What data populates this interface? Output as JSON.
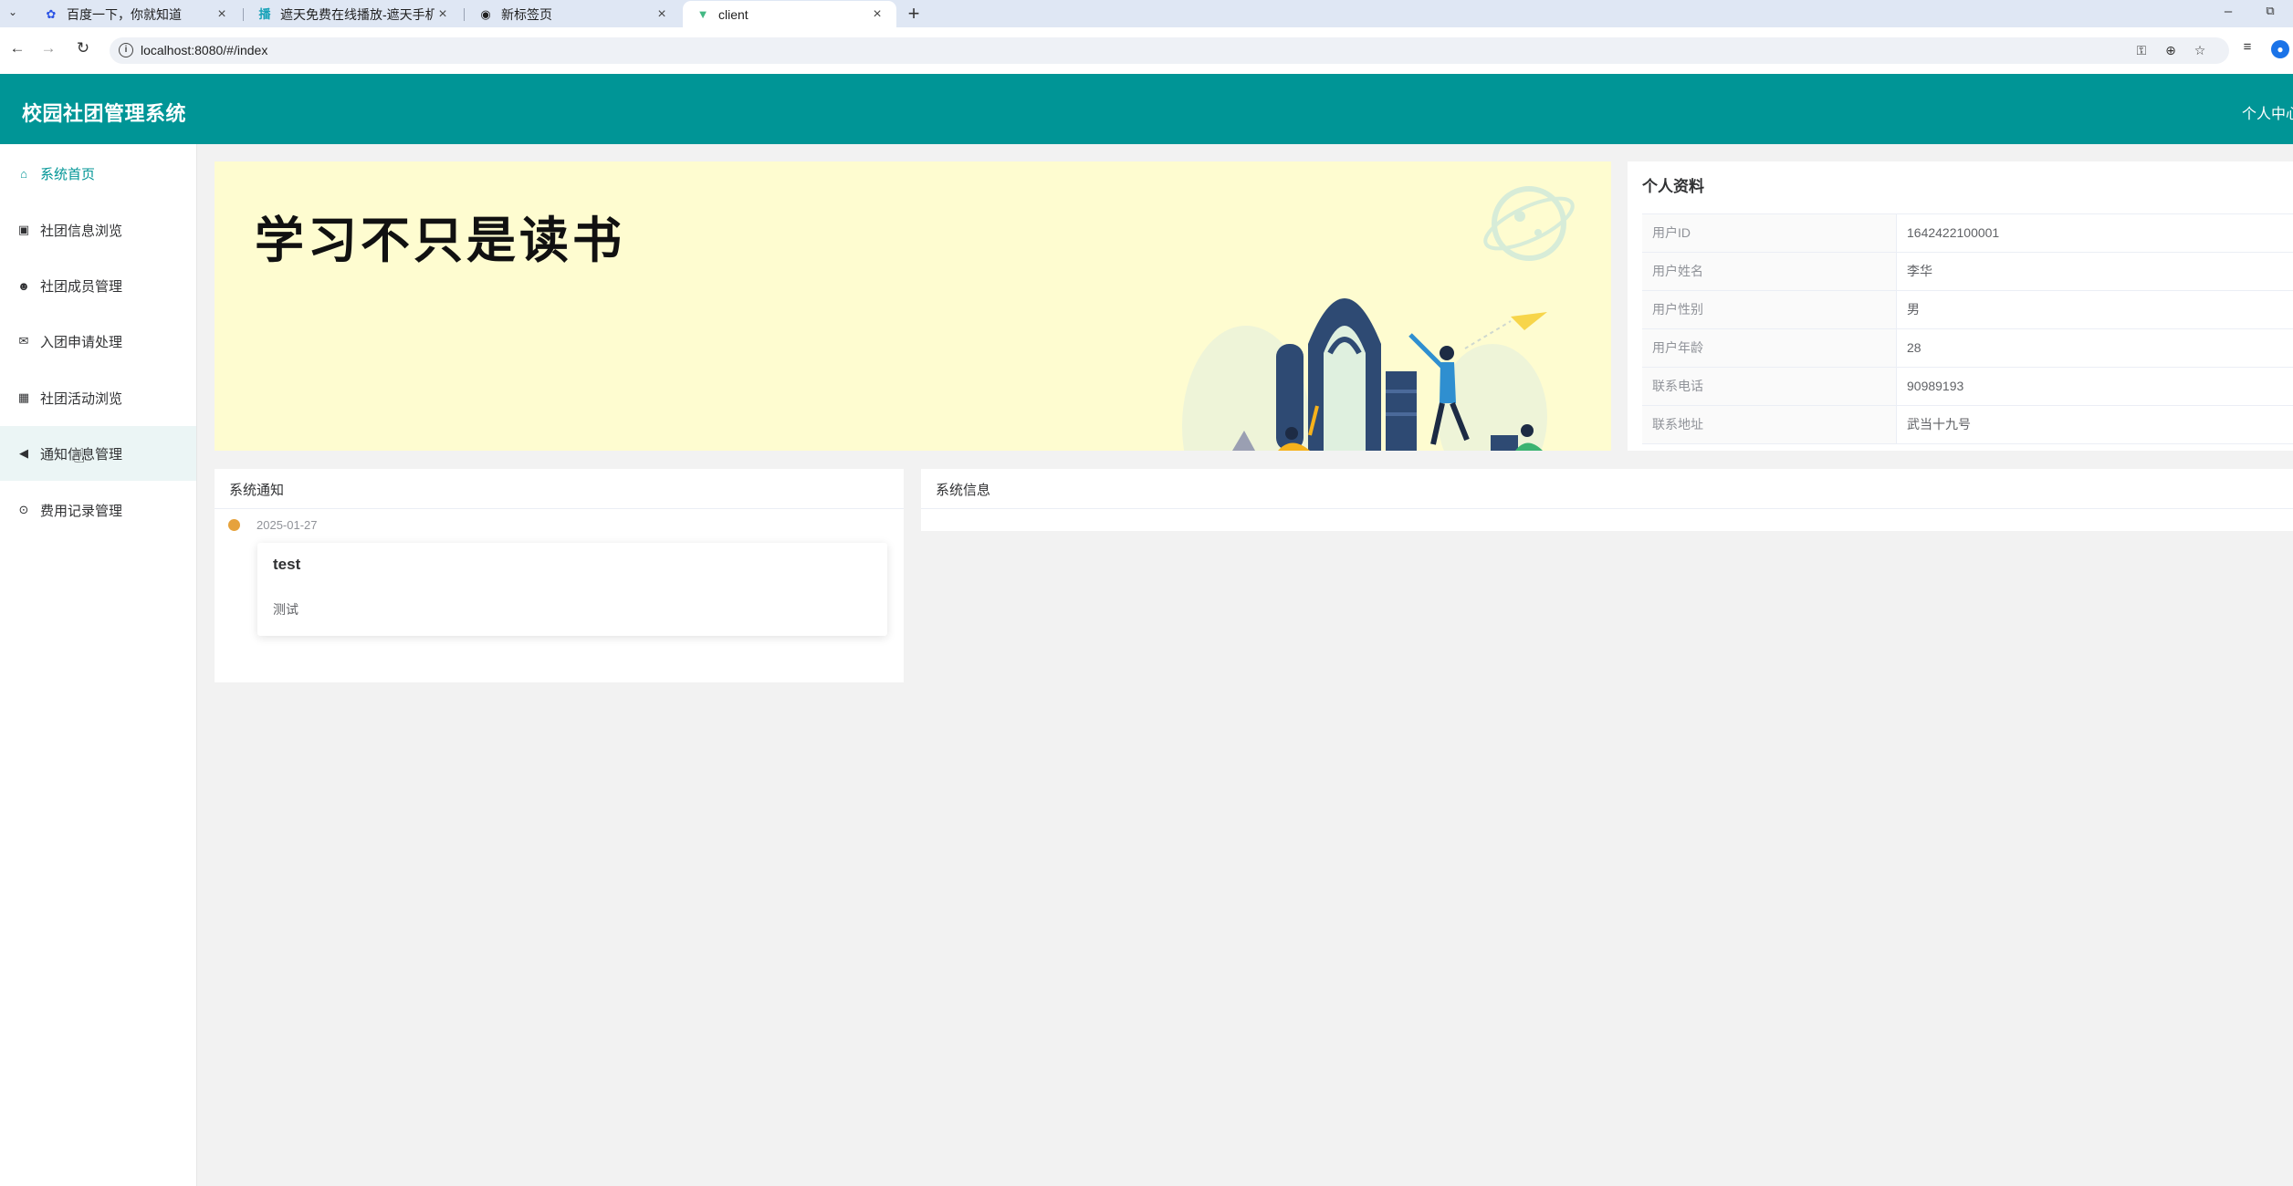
{
  "browser": {
    "tabs": [
      {
        "label": "百度一下，你就知道",
        "icon": "baidu-paw-icon"
      },
      {
        "label": "遮天免费在线播放-遮天手机高清",
        "icon": "video-site-icon"
      },
      {
        "label": "新标签页",
        "icon": "chrome-icon"
      },
      {
        "label": "client",
        "icon": "vue-logo-icon"
      }
    ],
    "active_tab": 3,
    "url": "localhost:8080/#/index"
  },
  "app": {
    "title": "校园社团管理系统",
    "user_center": "个人中心",
    "accent": "#009596"
  },
  "sidebar": {
    "items": [
      {
        "label": "系统首页",
        "icon": "home-icon"
      },
      {
        "label": "社团信息浏览",
        "icon": "train-icon"
      },
      {
        "label": "社团成员管理",
        "icon": "users-icon"
      },
      {
        "label": "入团申请处理",
        "icon": "envelope-icon"
      },
      {
        "label": "社团活动浏览",
        "icon": "calculator-icon"
      },
      {
        "label": "通知信息管理",
        "icon": "megaphone-icon"
      },
      {
        "label": "费用记录管理",
        "icon": "circle-icon"
      }
    ],
    "active_index": 0,
    "hover_index": 5
  },
  "banner": {
    "text": "学习不只是读书",
    "background": "#fefcd0"
  },
  "profile": {
    "title": "个人资料",
    "rows": [
      {
        "key": "用户ID",
        "value": "1642422100001"
      },
      {
        "key": "用户姓名",
        "value": "李华"
      },
      {
        "key": "用户性别",
        "value": "男"
      },
      {
        "key": "用户年龄",
        "value": "28"
      },
      {
        "key": "联系电话",
        "value": "90989193"
      },
      {
        "key": "联系地址",
        "value": "武当十九号"
      }
    ]
  },
  "notice": {
    "title": "系统通知",
    "items": [
      {
        "date": "2025-01-27",
        "title": "test",
        "content": "测试"
      }
    ]
  },
  "sysinfo": {
    "title": "系统信息"
  }
}
